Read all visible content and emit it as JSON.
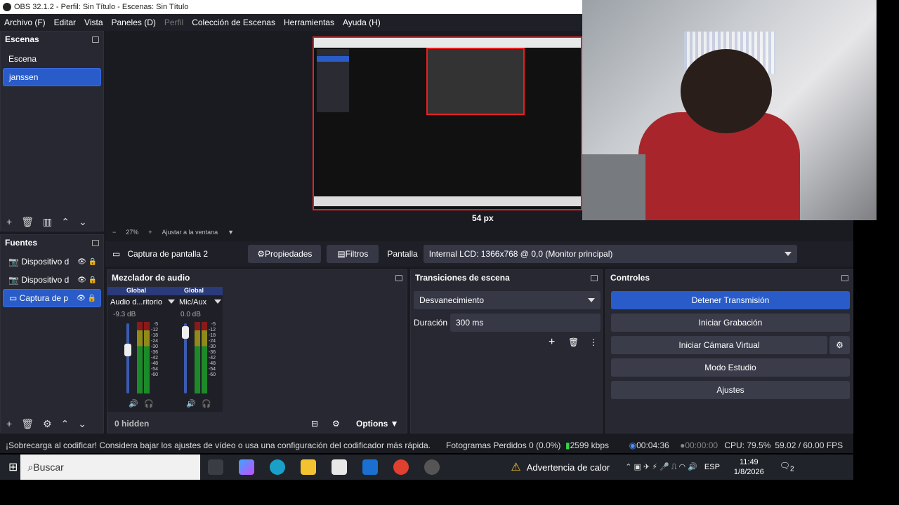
{
  "window": {
    "title": "OBS 32.1.2 - Perfil: Sin Título - Escenas: Sin Título"
  },
  "menu": [
    "Archivo (F)",
    "Editar",
    "Vista",
    "Paneles (D)",
    "Perfil",
    "Colección de Escenas",
    "Herramientas",
    "Ayuda (H)"
  ],
  "scenes": {
    "title": "Escenas",
    "items": [
      "Escena",
      "janssen"
    ],
    "selected": 1
  },
  "sources": {
    "title": "Fuentes",
    "items": [
      {
        "label": "Dispositivo d",
        "icon": "camera-icon"
      },
      {
        "label": "Dispositivo d",
        "icon": "camera-icon"
      },
      {
        "label": "Captura de p",
        "icon": "monitor-icon"
      }
    ],
    "selected": 2
  },
  "preview": {
    "zoom": "27%",
    "fit": "Ajustar a la ventana",
    "measure": "54 px"
  },
  "source_bar": {
    "name": "Captura de pantalla 2",
    "properties": "Propiedades",
    "filters": "Filtros",
    "display_label": "Pantalla",
    "display_value": "Internal LCD: 1366x768 @ 0,0 (Monitor principal)"
  },
  "mixer": {
    "title": "Mezclador de audio",
    "channels": [
      {
        "tag": "Global",
        "name": "Audio d...ritorio",
        "db": "-9.3 dB",
        "level": 0.65
      },
      {
        "tag": "Global",
        "name": "Mic/Aux",
        "db": "0.0 dB",
        "level": 0.95
      }
    ],
    "scale": [
      "-5",
      "-12",
      "-18",
      "-24",
      "-30",
      "-36",
      "-42",
      "-48",
      "-54",
      "-60"
    ],
    "hidden": "0 hidden",
    "options": "Options"
  },
  "transitions": {
    "title": "Transiciones de escena",
    "selected": "Desvanecimiento",
    "duration_label": "Duración",
    "duration_value": "300 ms"
  },
  "controls": {
    "title": "Controles",
    "buttons": [
      "Detener Transmisión",
      "Iniciar Grabación",
      "Iniciar Cámara Virtual",
      "Modo Estudio",
      "Ajustes"
    ]
  },
  "status": {
    "warning": "¡Sobrecarga al codificar! Considera bajar los ajustes de vídeo o usa una configuración del codificador más rápida.",
    "dropped": "Fotogramas Perdidos 0 (0.0%)",
    "bitrate": "2599 kbps",
    "stream_time": "00:04:36",
    "rec_time": "00:00:00",
    "cpu": "CPU: 79.5%",
    "fps": "59.02 / 60.00 FPS"
  },
  "taskbar": {
    "search": "Buscar",
    "heat_warning": "Advertencia de calor",
    "lang": "ESP",
    "time": "11:49",
    "date": "1/8/2026",
    "notif": "2"
  },
  "colors": {
    "accent": "#2a5cc9",
    "bg": "#1a1b21",
    "panel": "#272831"
  }
}
